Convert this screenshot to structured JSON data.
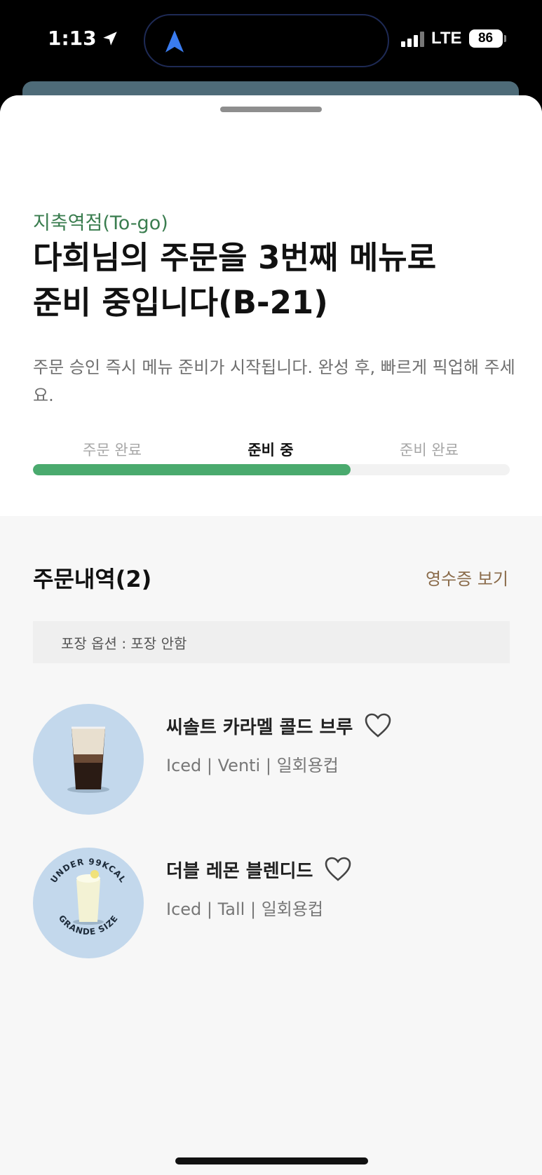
{
  "status_bar": {
    "time": "1:13",
    "network": "LTE",
    "battery": "86"
  },
  "order": {
    "store": "지축역점(To-go)",
    "headline_line1": "다희님의 주문을 3번째 메뉴로",
    "headline_line2": "준비 중입니다(B-21)",
    "description": "주문 승인 즉시 메뉴 준비가 시작됩니다. 완성 후, 빠르게 픽업해 주세요.",
    "steps": [
      {
        "label": "주문 완료",
        "active": false
      },
      {
        "label": "준비 중",
        "active": true
      },
      {
        "label": "준비 완료",
        "active": false
      }
    ],
    "progress_fraction": 0.666
  },
  "history": {
    "title": "주문내역(2)",
    "receipt_link": "영수증 보기",
    "pack_option": "포장 옵션 : 포장 안함",
    "items": [
      {
        "name": "씨솔트 카라멜 콜드 브루",
        "options": "Iced | Venti | 일회용컵"
      },
      {
        "name": "더블 레몬 블렌디드",
        "options": "Iced | Tall | 일회용컵",
        "badge_top": "UNDER 99KCAL",
        "badge_bottom": "GRANDE SIZE"
      }
    ]
  },
  "colors": {
    "accent_green": "#4aaa6e",
    "store_green": "#3a7d4f",
    "link_brown": "#8a6b4a",
    "thumb_blue": "#c3d8ec"
  }
}
